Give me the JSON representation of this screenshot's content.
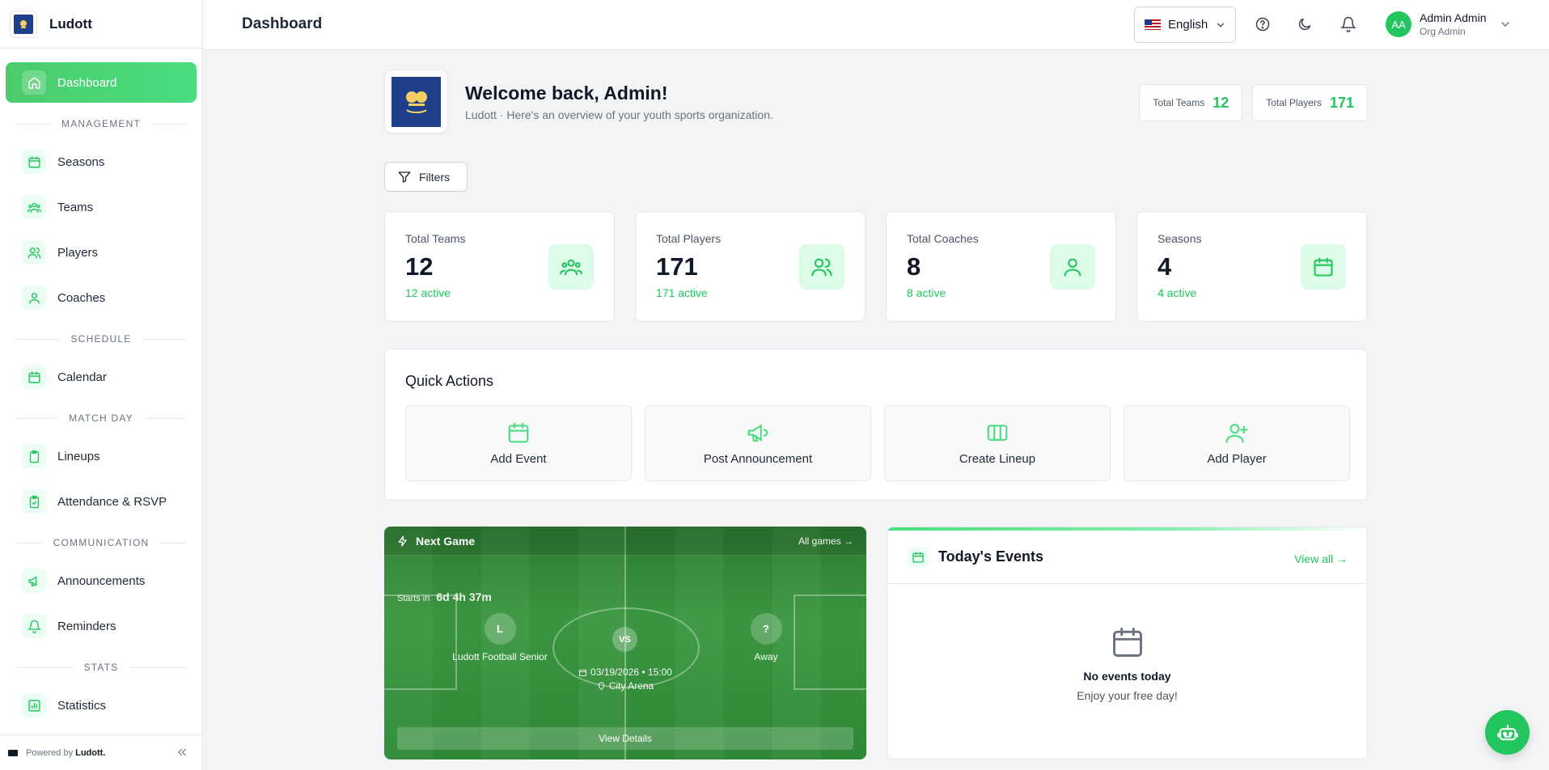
{
  "app": {
    "name": "Ludott"
  },
  "sidebar": {
    "dashboard": "Dashboard",
    "sections": {
      "management": "MANAGEMENT",
      "schedule": "SCHEDULE",
      "match_day": "MATCH DAY",
      "communication": "COMMUNICATION",
      "stats": "STATS"
    },
    "items": {
      "seasons": "Seasons",
      "teams": "Teams",
      "players": "Players",
      "coaches": "Coaches",
      "calendar": "Calendar",
      "lineups": "Lineups",
      "attendance": "Attendance & RSVP",
      "announcements": "Announcements",
      "reminders": "Reminders",
      "statistics": "Statistics"
    },
    "footer": {
      "powered_by": "Powered by",
      "brand": "Ludott."
    }
  },
  "topbar": {
    "title": "Dashboard",
    "language": "English",
    "user": {
      "initials": "AA",
      "name": "Admin Admin",
      "role": "Org Admin"
    }
  },
  "welcome": {
    "title": "Welcome back, Admin!",
    "subtitle": "Ludott · Here's an overview of your youth sports organization.",
    "pills": [
      {
        "label": "Total Teams",
        "value": "12"
      },
      {
        "label": "Total Players",
        "value": "171"
      }
    ]
  },
  "filters_label": "Filters",
  "stats": [
    {
      "label": "Total Teams",
      "value": "12",
      "active": "12 active",
      "icon": "users-group-icon"
    },
    {
      "label": "Total Players",
      "value": "171",
      "active": "171 active",
      "icon": "users-icon"
    },
    {
      "label": "Total Coaches",
      "value": "8",
      "active": "8 active",
      "icon": "user-icon"
    },
    {
      "label": "Seasons",
      "value": "4",
      "active": "4 active",
      "icon": "calendar-icon"
    }
  ],
  "quick_actions": {
    "title": "Quick Actions",
    "items": [
      "Add Event",
      "Post Announcement",
      "Create Lineup",
      "Add Player"
    ]
  },
  "next_game": {
    "title": "Next Game",
    "all_games": "All games →",
    "starts_in_label": "Starts in",
    "countdown": "6d 4h 37m",
    "home": {
      "initial": "L",
      "name": "Ludott Football Senior"
    },
    "vs": "VS",
    "away": {
      "initial": "?",
      "name": "Away"
    },
    "datetime": "03/19/2026 • 15:00",
    "venue": "City Arena",
    "details_button": "View Details"
  },
  "todays_events": {
    "title": "Today's Events",
    "view_all": "View all →",
    "empty_title": "No events today",
    "empty_sub": "Enjoy your free day!"
  },
  "colors": {
    "accent": "#22c55e",
    "accent_light": "#4ade80",
    "pitch": "#2e7d32"
  }
}
